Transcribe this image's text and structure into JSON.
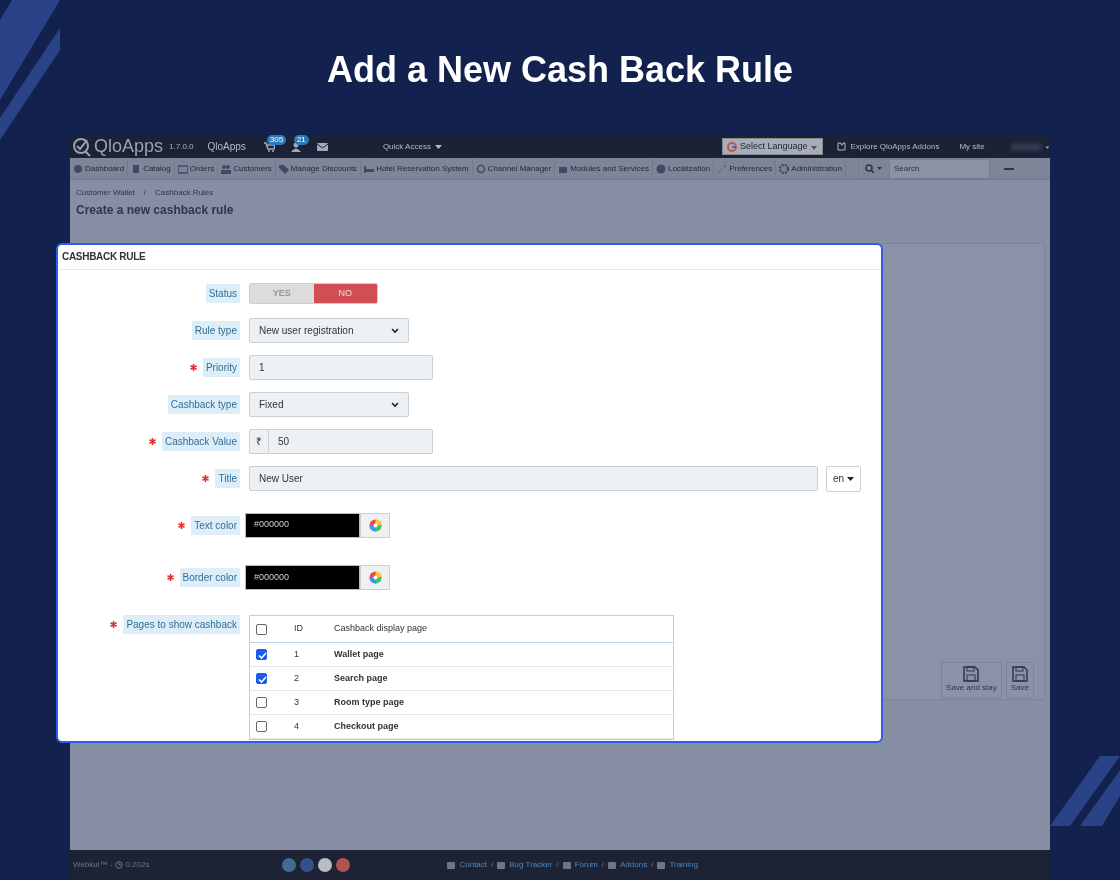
{
  "header": {
    "title": "Add a New Cash Back Rule"
  },
  "topbar": {
    "logo": "QloApps",
    "version": "1.7.0.0",
    "shop_name": "QloApps",
    "notifications": [
      {
        "kind": "cart",
        "count": "305"
      },
      {
        "kind": "user",
        "count": "21"
      },
      {
        "kind": "mail"
      }
    ],
    "quick_access": "Quick Access",
    "language": "Select Language",
    "addons": "Explore QloApps Addons",
    "my_site": "My site"
  },
  "menu": [
    {
      "label": "Dashboard"
    },
    {
      "label": "Catalog"
    },
    {
      "label": "Orders"
    },
    {
      "label": "Customers"
    },
    {
      "label": "Manage Discounts"
    },
    {
      "label": "Hotel Reservation System"
    },
    {
      "label": "Channel Manager"
    },
    {
      "label": "Modules and Services"
    },
    {
      "label": "Localization"
    },
    {
      "label": "Preferences"
    },
    {
      "label": "Administration"
    }
  ],
  "search": {
    "placeholder": "Search"
  },
  "breadcrumb": {
    "items": [
      "Customer Wallet",
      "Cashback Rules"
    ],
    "separator": "/"
  },
  "page_title": "Create a new cashback rule",
  "toolbar": [
    {
      "label": "Save and stay"
    },
    {
      "label": "Save"
    }
  ],
  "form": {
    "title": "CASHBACK RULE",
    "fields": [
      {
        "kind": "switch",
        "label": "Status",
        "required": false,
        "options": [
          {
            "label": "YES",
            "selected": false
          },
          {
            "label": "NO",
            "selected": true
          }
        ]
      },
      {
        "kind": "select",
        "label": "Rule type",
        "required": false,
        "value": "New user registration"
      },
      {
        "kind": "text",
        "label": "Priority",
        "required": true,
        "value": "1"
      },
      {
        "kind": "select",
        "label": "Cashback type",
        "required": false,
        "value": "Fixed"
      },
      {
        "kind": "money",
        "label": "Cashback Value",
        "required": true,
        "prefix": "₹",
        "value": "50"
      },
      {
        "kind": "lang_text",
        "label": "Title",
        "required": true,
        "value": "New User",
        "lang": "en"
      },
      {
        "kind": "color",
        "label": "Text color",
        "required": true,
        "value": "#000000"
      },
      {
        "kind": "color",
        "label": "Border color",
        "required": true,
        "value": "#000000"
      },
      {
        "kind": "pages",
        "label": "Pages to show cashback",
        "required": true,
        "all_checked": false,
        "columns": [
          "ID",
          "Cashback display page"
        ],
        "rows": [
          {
            "id": "1",
            "name": "Wallet page",
            "checked": true
          },
          {
            "id": "2",
            "name": "Search page",
            "checked": true
          },
          {
            "id": "3",
            "name": "Room type page",
            "checked": false
          },
          {
            "id": "4",
            "name": "Checkout page",
            "checked": false
          }
        ]
      }
    ]
  },
  "footer": {
    "credit": "Webkul™ -",
    "time": "0.202s",
    "social": [
      {
        "color": "#3f6d96"
      },
      {
        "color": "#34508a"
      },
      {
        "color": "#b8bcc6"
      },
      {
        "color": "#b0554d"
      }
    ],
    "links": [
      {
        "label": "Contact",
        "separator": "/"
      },
      {
        "label": "Bug Tracker",
        "separator": "/"
      },
      {
        "label": "Forum",
        "separator": "/"
      },
      {
        "label": "Addons",
        "separator": "/"
      },
      {
        "label": "Training"
      }
    ]
  }
}
